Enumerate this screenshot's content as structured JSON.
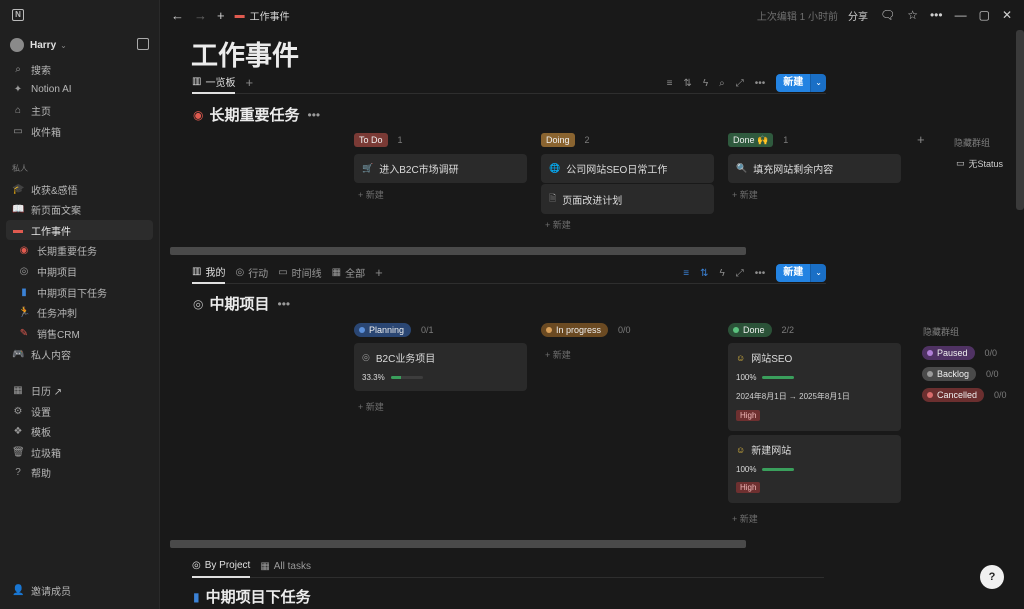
{
  "sidebar": {
    "workspace": "Harry",
    "top_items": [
      {
        "icon": "search-icon",
        "label": "搜索"
      },
      {
        "icon": "notion-ai-icon",
        "label": "Notion AI"
      },
      {
        "icon": "home-icon",
        "label": "主页"
      },
      {
        "icon": "inbox-icon",
        "label": "收件箱"
      }
    ],
    "section_label": "私人",
    "private_items": [
      {
        "icon": "graduation-icon",
        "label": "收获&感悟"
      },
      {
        "icon": "book-icon",
        "label": "新页面文案"
      },
      {
        "icon": "laptop-icon",
        "label": "工作事件"
      },
      {
        "icon": "target-icon",
        "label": "长期重要任务"
      },
      {
        "icon": "target-outline-icon",
        "label": "中期项目"
      },
      {
        "icon": "doc-icon",
        "label": "中期项目下任务"
      },
      {
        "icon": "runner-icon",
        "label": "任务冲刺"
      },
      {
        "icon": "pencil-icon",
        "label": "销售CRM"
      },
      {
        "icon": "game-icon",
        "label": "私人内容"
      }
    ],
    "bottom_items": [
      {
        "icon": "calendar-icon",
        "label": "日历 ↗"
      },
      {
        "icon": "gear-icon",
        "label": "设置"
      },
      {
        "icon": "template-icon",
        "label": "模板"
      },
      {
        "icon": "trash-icon",
        "label": "垃圾箱"
      },
      {
        "icon": "help-icon",
        "label": "帮助"
      }
    ],
    "invite": "邀请成员"
  },
  "topbar": {
    "breadcrumb": "工作事件",
    "last_edited": "上次编辑 1 小时前",
    "share": "分享"
  },
  "page": {
    "title": "工作事件"
  },
  "view1": {
    "tabs": [
      {
        "icon": "board-icon",
        "label": "一览板"
      }
    ],
    "new_label": "新建"
  },
  "db1": {
    "title": "长期重要任务",
    "columns": [
      {
        "tag": "To Do",
        "count": "1",
        "color": "#7a3a35"
      },
      {
        "tag": "Doing",
        "count": "2",
        "color": "#8a6430"
      },
      {
        "tag": "Done 🙌",
        "count": "1",
        "color": "#2f5a3e"
      }
    ],
    "cards": [
      {
        "label": "进入B2C市场调研",
        "icon": "cart-icon"
      },
      {
        "label": "公司网站SEO日常工作",
        "icon": "globe-icon"
      },
      {
        "label": "页面改进计划",
        "icon": "doc-icon"
      },
      {
        "label": "填充网站剩余内容",
        "icon": "magnifier-icon"
      }
    ],
    "new_row": "+ 新建",
    "hidden_group_label": "隐藏群组",
    "hidden_no_status": "无Status"
  },
  "view2": {
    "tabs": [
      {
        "icon": "board-icon",
        "label": "我的"
      },
      {
        "icon": "target-icon",
        "label": "行动"
      },
      {
        "icon": "timeline-icon",
        "label": "时间线"
      },
      {
        "icon": "table-icon",
        "label": "全部"
      }
    ],
    "new_label": "新建"
  },
  "db2": {
    "title": "中期项目",
    "columns": [
      {
        "tag": "Planning",
        "count": "0/1",
        "color": "#2a4673",
        "dot": "#5b8fd9"
      },
      {
        "tag": "In progress",
        "count": "0/0",
        "color": "#6b4a22",
        "dot": "#d9a15b"
      },
      {
        "tag": "Done",
        "count": "2/2",
        "color": "#2b5238",
        "dot": "#5bc27e"
      }
    ],
    "cards": [
      {
        "label": "B2C业务项目",
        "progress": "33.3%",
        "value": 0.333
      },
      {
        "label": "网站SEO",
        "progress": "100%",
        "value": 1.0,
        "dates": "2024年8月1日 → 2025年8月1日",
        "badge": "High"
      },
      {
        "label": "新建网站",
        "progress": "100%",
        "value": 1.0,
        "badge": "High"
      }
    ],
    "new_row": "+ 新建",
    "hidden_group_label": "隐藏群组",
    "hidden_groups": [
      {
        "tag": "Paused",
        "count": "0/0",
        "color": "#4f3263",
        "dot": "#b07fd6"
      },
      {
        "tag": "Backlog",
        "count": "0/0",
        "color": "#4a4a4a",
        "dot": "#9a9a9a"
      },
      {
        "tag": "Cancelled",
        "count": "0/0",
        "color": "#6b2f2f",
        "dot": "#d96b6b"
      }
    ]
  },
  "view3": {
    "tabs": [
      {
        "icon": "target-icon",
        "label": "By Project"
      },
      {
        "icon": "table-icon",
        "label": "All tasks"
      }
    ]
  },
  "db3": {
    "title": "中期项目下任务"
  }
}
